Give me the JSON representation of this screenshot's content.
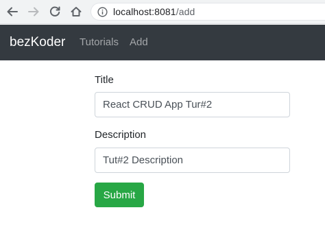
{
  "browser": {
    "url_host": "localhost:8081",
    "url_path": "/add",
    "icons": {
      "back": "back-arrow-icon",
      "forward": "forward-arrow-icon",
      "reload": "reload-icon",
      "home": "home-icon",
      "info": "info-icon"
    }
  },
  "navbar": {
    "brand": "bezKoder",
    "links": [
      {
        "label": "Tutorials"
      },
      {
        "label": "Add"
      }
    ],
    "background": "#343a40"
  },
  "form": {
    "title_label": "Title",
    "title_value": "React CRUD App Tur#2",
    "description_label": "Description",
    "description_value": "Tut#2 Description",
    "submit_label": "Submit",
    "submit_color": "#28a745"
  }
}
